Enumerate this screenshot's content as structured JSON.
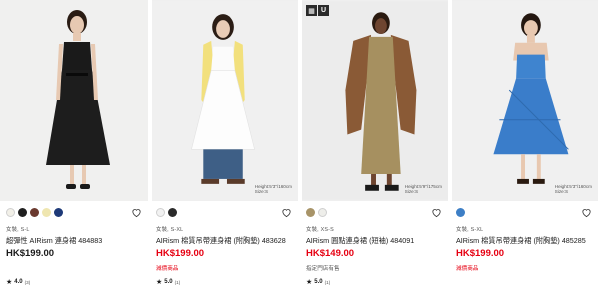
{
  "products": [
    {
      "photo_bg": "#f0f0ef",
      "garment_color": "#1a1a1a",
      "model_note": null,
      "badge": null,
      "swatches": [
        "#f2f0e8",
        "#1f1f1f",
        "#6b3a2f",
        "#efe6b0",
        "#1e3a78"
      ],
      "meta": "女裝, S-L",
      "name": "超彈性 AIRism 連身裙 484883",
      "price": "HK$199.00",
      "price_sale": false,
      "flag": "",
      "rating": "4.0",
      "rating_count": "(3)"
    },
    {
      "photo_bg": "#f0f0f0",
      "garment_color": "#fbfbfb",
      "model_note": {
        "line1": "Height:5'3\"/160cm",
        "line2": "Size:S"
      },
      "badge": null,
      "swatches": [
        "#f2f2f2",
        "#2a2a2a"
      ],
      "meta": "女裝, S-XL",
      "name": "AIRism 棉質吊帶連身裙 (附胸墊) 483628",
      "price": "HK$199.00",
      "price_sale": true,
      "flag": "減價商品",
      "rating": "5.0",
      "rating_count": "(1)"
    },
    {
      "photo_bg": "#ececec",
      "garment_color": "#a69060",
      "model_note": {
        "line1": "Height:5'9\"/175cm",
        "line2": "Size:S"
      },
      "badge": {
        "a": "▦",
        "b": "U"
      },
      "swatches": [
        "#a89468",
        "#eeeeea"
      ],
      "meta": "女裝, XS-S",
      "name": "AIRism 圓點連身裙 (短袖) 484091",
      "price": "HK$149.00",
      "price_sale": true,
      "flag": "指定門店有售",
      "flag_store": true,
      "rating": "5.0",
      "rating_count": "(1)"
    },
    {
      "photo_bg": "#f0f0f0",
      "garment_color": "#3f84cf",
      "model_note": {
        "line1": "Height:5'3\"/160cm",
        "line2": "Size:S"
      },
      "badge": null,
      "swatches": [
        "#3d7fc6"
      ],
      "meta": "女裝, S-XL",
      "name": "AIRism 棉質吊帶連身裙 (附胸墊) 485285",
      "price": "HK$199.00",
      "price_sale": true,
      "flag": "減價商品",
      "rating": "",
      "rating_count": ""
    }
  ]
}
